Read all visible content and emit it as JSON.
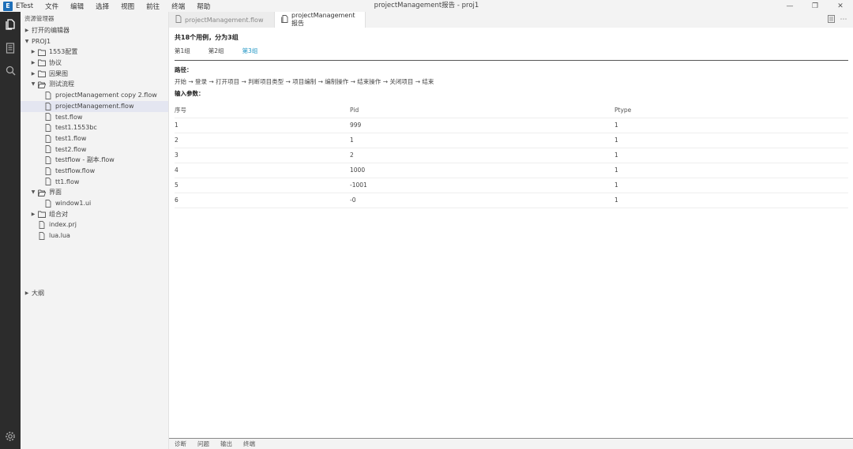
{
  "app": {
    "name": "ETest",
    "logo_letter": "E"
  },
  "menu": [
    "文件",
    "编辑",
    "选择",
    "视图",
    "前往",
    "终端",
    "帮助"
  ],
  "window_title": "projectManagement报告 - proj1",
  "window_controls": {
    "minimize": "—",
    "restore": "❐",
    "close": "✕"
  },
  "sidebar": {
    "header": "资源管理器",
    "open_editors": "打开的编辑器",
    "project": "PROJ1",
    "outline": "大纲",
    "tree": [
      {
        "label": "1553配置",
        "type": "folder",
        "level": 1,
        "expanded": false
      },
      {
        "label": "协议",
        "type": "folder",
        "level": 1,
        "expanded": false
      },
      {
        "label": "因果图",
        "type": "folder",
        "level": 1,
        "expanded": false
      },
      {
        "label": "测试流程",
        "type": "folder",
        "level": 1,
        "expanded": true
      },
      {
        "label": "projectManagement copy 2.flow",
        "type": "file",
        "level": 2
      },
      {
        "label": "projectManagement.flow",
        "type": "file",
        "level": 2,
        "selected": true
      },
      {
        "label": "test.flow",
        "type": "file",
        "level": 2
      },
      {
        "label": "test1.1553bc",
        "type": "file",
        "level": 2
      },
      {
        "label": "test1.flow",
        "type": "file",
        "level": 2
      },
      {
        "label": "test2.flow",
        "type": "file",
        "level": 2
      },
      {
        "label": "testflow - 副本.flow",
        "type": "file",
        "level": 2
      },
      {
        "label": "testflow.flow",
        "type": "file",
        "level": 2
      },
      {
        "label": "tt1.flow",
        "type": "file",
        "level": 2
      },
      {
        "label": "界面",
        "type": "folder",
        "level": 1,
        "expanded": true
      },
      {
        "label": "window1.ui",
        "type": "file",
        "level": 2
      },
      {
        "label": "组合对",
        "type": "folder",
        "level": 1,
        "expanded": false
      },
      {
        "label": "index.prj",
        "type": "file",
        "level": 1
      },
      {
        "label": "lua.lua",
        "type": "file",
        "level": 1
      }
    ]
  },
  "tabs": [
    {
      "label": "projectManagement.flow",
      "active": false
    },
    {
      "label": "projectManagement报告",
      "active": true
    }
  ],
  "report": {
    "summary": "共18个用例，分为3组",
    "groups": [
      "第1组",
      "第2组",
      "第3组"
    ],
    "active_group": 2,
    "path_label": "路径：",
    "path": "开始 → 登录 → 打开项目 → 判断项目类型 → 项目编制 → 编制操作 → 结束操作 → 关闭项目 → 结束",
    "params_label": "输入参数：",
    "columns": [
      "序号",
      "Pid",
      "Ptype"
    ],
    "rows": [
      [
        "1",
        "999",
        "1"
      ],
      [
        "2",
        "1",
        "1"
      ],
      [
        "3",
        "2",
        "1"
      ],
      [
        "4",
        "1000",
        "1"
      ],
      [
        "5",
        "-1001",
        "1"
      ],
      [
        "6",
        "-0",
        "1"
      ]
    ]
  },
  "panel_tabs": [
    "诊断",
    "问题",
    "输出",
    "终端"
  ],
  "colors": {
    "activity_bar": "#2c2c2c",
    "selected_row": "#e4e6f1",
    "active_group": "#2196c4",
    "logo": "#1e6fb8"
  }
}
